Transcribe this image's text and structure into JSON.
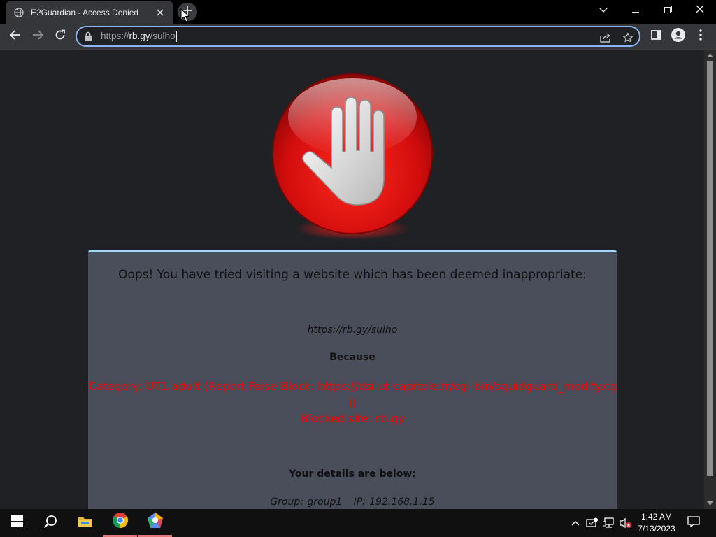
{
  "browser": {
    "tab": {
      "title": "E2Guardian - Access Denied",
      "favicon": "globe-icon"
    },
    "address": {
      "scheme": "https://",
      "host": "rb.gy",
      "path": "/sulho"
    },
    "accent_color": "#8ab4f8"
  },
  "page": {
    "logo": "stop-hand-icon",
    "headline": "Oops! You have tried visiting a website which has been deemed inappropriate:",
    "blocked_url": "https://rb.gy/sulho",
    "because_label": "Because",
    "reason_category": "Category: UT1 adult (Report False Block: https://dsi.ut-capitole.fr/cgi-bin/squidguard_modify.cgi)",
    "reason_site": "Blocked site: rb.gy",
    "details_label": "Your details are below:",
    "details_text": "Group: group1   IP: 192.168.1.15",
    "reason_color": "#ff0000",
    "panel_color": "#4a4d5a"
  },
  "taskbar": {
    "apps": [
      "start-icon",
      "search-icon",
      "file-explorer-icon",
      "chrome-icon",
      "app-icon"
    ],
    "clock": {
      "time": "1:42 AM",
      "date": "7/13/2023"
    }
  }
}
